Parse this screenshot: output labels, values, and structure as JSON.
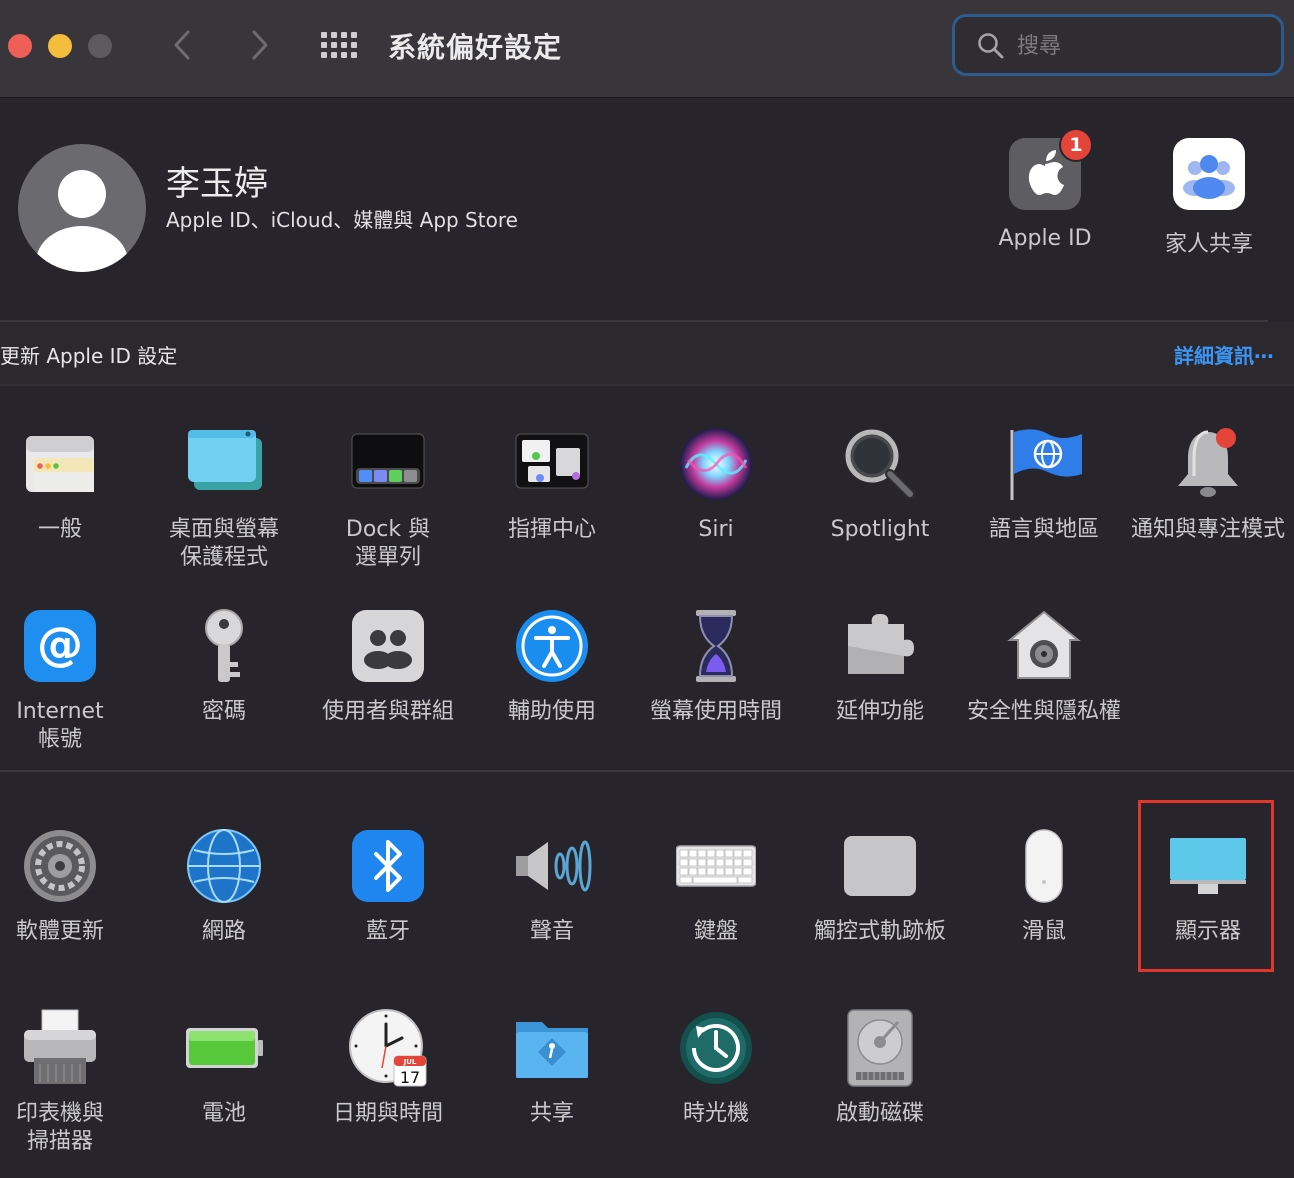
{
  "window": {
    "title": "系統偏好設定",
    "search_placeholder": "搜尋"
  },
  "account": {
    "name": "李玉婷",
    "subtitle": "Apple ID、iCloud、媒體與 App Store",
    "tiles": [
      {
        "label": "Apple ID",
        "icon": "apple-id-icon",
        "badge": "1"
      },
      {
        "label": "家人共享",
        "icon": "family-sharing-icon"
      }
    ]
  },
  "notice": {
    "text": "更新 Apple ID 設定",
    "link": "詳細資訊⋯"
  },
  "sections": {
    "row1": [
      {
        "label": "一般",
        "icon": "general-icon"
      },
      {
        "label": "桌面與螢幕\n保護程式",
        "icon": "desktop-screensaver-icon"
      },
      {
        "label": "Dock 與\n選單列",
        "icon": "dock-icon"
      },
      {
        "label": "指揮中心",
        "icon": "mission-control-icon"
      },
      {
        "label": "Siri",
        "icon": "siri-icon"
      },
      {
        "label": "Spotlight",
        "icon": "spotlight-icon"
      },
      {
        "label": "語言與地區",
        "icon": "language-region-icon"
      },
      {
        "label": "通知與專注模式",
        "icon": "notifications-icon"
      }
    ],
    "row2": [
      {
        "label": "Internet\n帳號",
        "icon": "internet-accounts-icon"
      },
      {
        "label": "密碼",
        "icon": "passwords-icon"
      },
      {
        "label": "使用者與群組",
        "icon": "users-groups-icon"
      },
      {
        "label": "輔助使用",
        "icon": "accessibility-icon"
      },
      {
        "label": "螢幕使用時間",
        "icon": "screen-time-icon"
      },
      {
        "label": "延伸功能",
        "icon": "extensions-icon"
      },
      {
        "label": "安全性與隱私權",
        "icon": "security-privacy-icon"
      }
    ],
    "row3": [
      {
        "label": "軟體更新",
        "icon": "software-update-icon"
      },
      {
        "label": "網路",
        "icon": "network-icon"
      },
      {
        "label": "藍牙",
        "icon": "bluetooth-icon"
      },
      {
        "label": "聲音",
        "icon": "sound-icon"
      },
      {
        "label": "鍵盤",
        "icon": "keyboard-icon"
      },
      {
        "label": "觸控式軌跡板",
        "icon": "trackpad-icon"
      },
      {
        "label": "滑鼠",
        "icon": "mouse-icon"
      },
      {
        "label": "顯示器",
        "icon": "displays-icon",
        "highlighted": true
      }
    ],
    "row4": [
      {
        "label": "印表機與\n掃描器",
        "icon": "printers-scanners-icon"
      },
      {
        "label": "電池",
        "icon": "battery-icon"
      },
      {
        "label": "日期與時間",
        "icon": "date-time-icon",
        "calendar_month": "JUL",
        "calendar_day": "17"
      },
      {
        "label": "共享",
        "icon": "sharing-icon"
      },
      {
        "label": "時光機",
        "icon": "time-machine-icon"
      },
      {
        "label": "啟動磁碟",
        "icon": "startup-disk-icon"
      }
    ]
  },
  "colors": {
    "background": "#27252b",
    "toolbar": "#38363b",
    "accent_link": "#3c95f5",
    "highlight_box": "#e1362b"
  }
}
